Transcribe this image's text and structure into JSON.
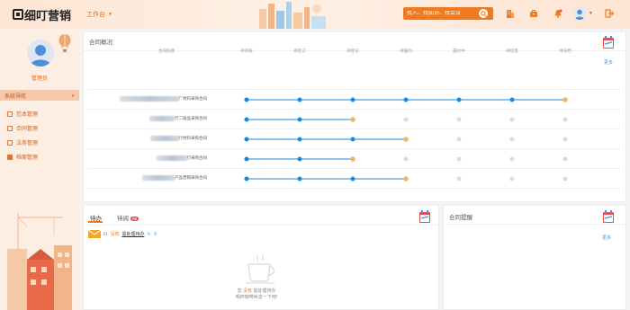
{
  "header": {
    "logo_text": "细叮营销",
    "workspace_label": "工作台",
    "search_placeholder": "找人、找知识、找会议"
  },
  "sidebar": {
    "user_name": "管理员",
    "section_label": "系统导航",
    "items": [
      {
        "label": "范本管理"
      },
      {
        "label": "合同管理"
      },
      {
        "label": "法务管理"
      },
      {
        "label": "档案管理"
      }
    ]
  },
  "overview": {
    "title": "合同概况",
    "more": "更多",
    "columns": [
      "合同标题",
      "待审核",
      "待签订",
      "待登记",
      "待履约",
      "履约中",
      "待续签",
      "待归档"
    ],
    "rows": [
      {
        "name_suffix": "厂材料采购合同",
        "progress": 6
      },
      {
        "name_suffix": "行二级品采购合同",
        "progress": 2
      },
      {
        "name_suffix": "行材料采购合同",
        "progress": 3
      },
      {
        "name_suffix": "行采购合同",
        "progress": 2
      },
      {
        "name_suffix": "产品营销采购合同",
        "progress": 3
      }
    ]
  },
  "tasks": {
    "tab_todo": "待办",
    "tab_pending": "待阅",
    "pending_count": "99",
    "todo_none": "没有",
    "todo_pending_label": "需处理待办",
    "empty_text_prefix": "您",
    "empty_text_highlight": "没有",
    "empty_text_suffix": "需处理待办",
    "empty_line2": "喝杯咖啡休息一下吧!"
  },
  "reminder": {
    "title": "合同提醒",
    "more": "更多"
  },
  "colors": {
    "accent": "#f07a1f",
    "done": "#1e88d8",
    "current": "#f5b26b",
    "todo": "#dcdcdc"
  }
}
